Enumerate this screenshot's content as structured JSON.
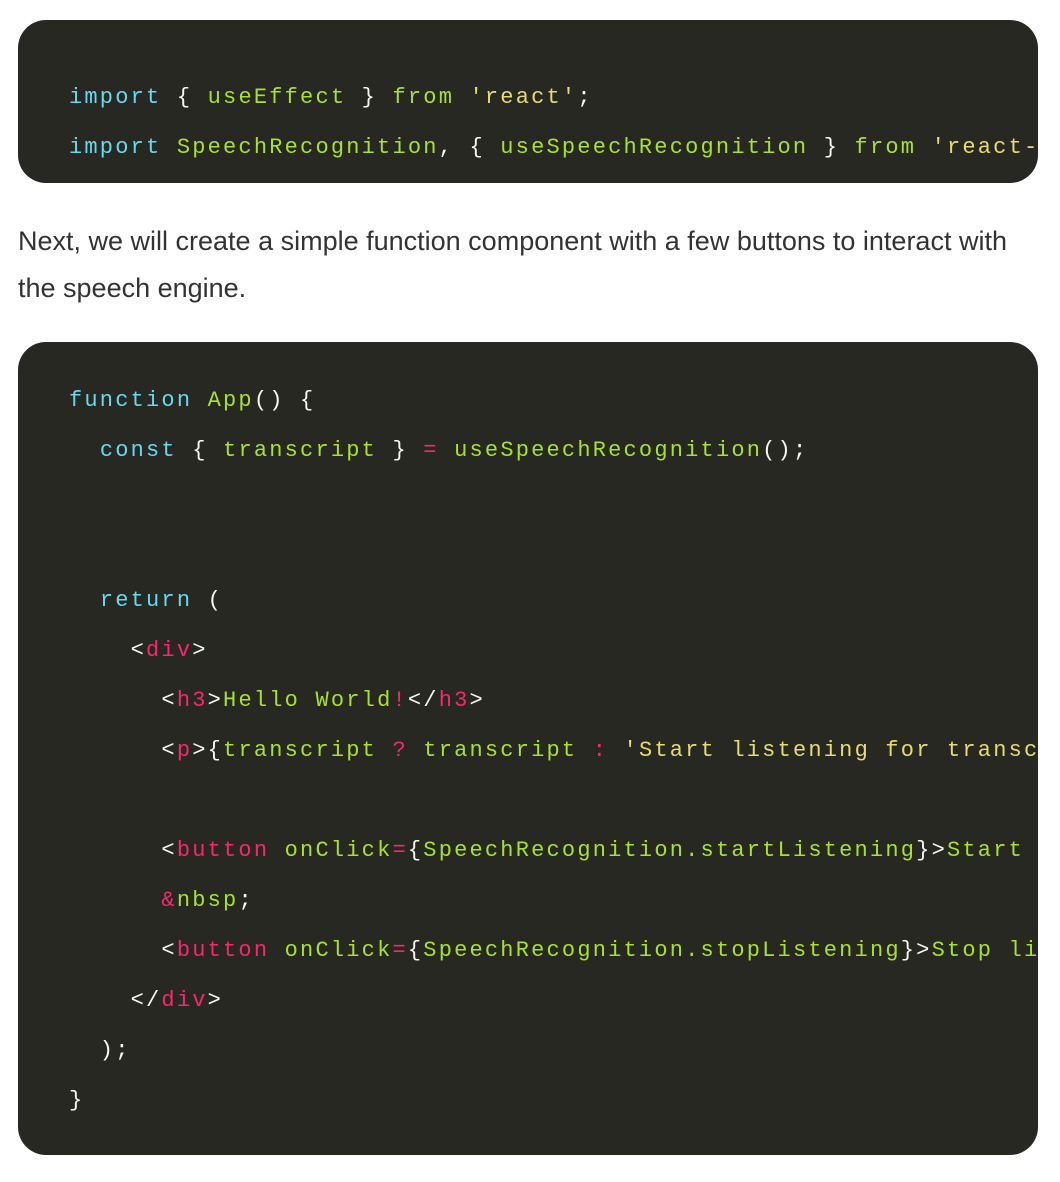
{
  "colors": {
    "background": "#272822",
    "keyword": "#66d9ef",
    "name": "#a6e22e",
    "string": "#e6db74",
    "tag": "#f92672",
    "plain": "#f8f8f2"
  },
  "code_block_1": {
    "lines": [
      [
        {
          "c": "k",
          "t": "import"
        },
        {
          "c": "w",
          "t": " { "
        },
        {
          "c": "g",
          "t": "useEffect"
        },
        {
          "c": "w",
          "t": " } "
        },
        {
          "c": "g",
          "t": "from"
        },
        {
          "c": "w",
          "t": " "
        },
        {
          "c": "y",
          "t": "'react'"
        },
        {
          "c": "w",
          "t": ";"
        }
      ],
      [
        {
          "c": "k",
          "t": "import"
        },
        {
          "c": "w",
          "t": " "
        },
        {
          "c": "g",
          "t": "SpeechRecognition"
        },
        {
          "c": "w",
          "t": ", { "
        },
        {
          "c": "g",
          "t": "useSpeechRecognition"
        },
        {
          "c": "w",
          "t": " } "
        },
        {
          "c": "g",
          "t": "from"
        },
        {
          "c": "w",
          "t": " "
        },
        {
          "c": "y",
          "t": "'react-spe"
        }
      ]
    ]
  },
  "paragraph": "Next, we will create a simple function component with a few buttons to interact with the speech engine.",
  "code_block_2": {
    "lines": [
      [
        {
          "c": "k",
          "t": "function"
        },
        {
          "c": "w",
          "t": " "
        },
        {
          "c": "g",
          "t": "App"
        },
        {
          "c": "w",
          "t": "() {"
        }
      ],
      [
        {
          "c": "w",
          "t": "  "
        },
        {
          "c": "k",
          "t": "const"
        },
        {
          "c": "w",
          "t": " { "
        },
        {
          "c": "g",
          "t": "transcript"
        },
        {
          "c": "w",
          "t": " } "
        },
        {
          "c": "p",
          "t": "="
        },
        {
          "c": "w",
          "t": " "
        },
        {
          "c": "g",
          "t": "useSpeechRecognition"
        },
        {
          "c": "w",
          "t": "();"
        }
      ],
      [],
      [],
      [
        {
          "c": "w",
          "t": "  "
        },
        {
          "c": "k",
          "t": "return"
        },
        {
          "c": "w",
          "t": " ("
        }
      ],
      [
        {
          "c": "w",
          "t": "    <"
        },
        {
          "c": "p",
          "t": "div"
        },
        {
          "c": "w",
          "t": ">"
        }
      ],
      [
        {
          "c": "w",
          "t": "      <"
        },
        {
          "c": "p",
          "t": "h3"
        },
        {
          "c": "w",
          "t": ">"
        },
        {
          "c": "g",
          "t": "Hello World"
        },
        {
          "c": "p",
          "t": "!"
        },
        {
          "c": "w",
          "t": "</"
        },
        {
          "c": "p",
          "t": "h3"
        },
        {
          "c": "w",
          "t": ">"
        }
      ],
      [
        {
          "c": "w",
          "t": "      <"
        },
        {
          "c": "p",
          "t": "p"
        },
        {
          "c": "w",
          "t": ">{"
        },
        {
          "c": "g",
          "t": "transcript"
        },
        {
          "c": "p",
          "t": " ? "
        },
        {
          "c": "g",
          "t": "transcript"
        },
        {
          "c": "p",
          "t": " : "
        },
        {
          "c": "y",
          "t": "'Start listening for transcrip"
        }
      ],
      [],
      [
        {
          "c": "w",
          "t": "      <"
        },
        {
          "c": "p",
          "t": "button"
        },
        {
          "c": "w",
          "t": " "
        },
        {
          "c": "g",
          "t": "onClick"
        },
        {
          "c": "p",
          "t": "="
        },
        {
          "c": "w",
          "t": "{"
        },
        {
          "c": "g",
          "t": "SpeechRecognition.startListening"
        },
        {
          "c": "w",
          "t": "}>"
        },
        {
          "c": "g",
          "t": "Start lis"
        }
      ],
      [
        {
          "c": "w",
          "t": "      "
        },
        {
          "c": "p",
          "t": "&"
        },
        {
          "c": "g",
          "t": "nbsp"
        },
        {
          "c": "w",
          "t": ";"
        }
      ],
      [
        {
          "c": "w",
          "t": "      <"
        },
        {
          "c": "p",
          "t": "button"
        },
        {
          "c": "w",
          "t": " "
        },
        {
          "c": "g",
          "t": "onClick"
        },
        {
          "c": "p",
          "t": "="
        },
        {
          "c": "w",
          "t": "{"
        },
        {
          "c": "g",
          "t": "SpeechRecognition.stopListening"
        },
        {
          "c": "w",
          "t": "}>"
        },
        {
          "c": "g",
          "t": "Stop liste"
        }
      ],
      [
        {
          "c": "w",
          "t": "    </"
        },
        {
          "c": "p",
          "t": "div"
        },
        {
          "c": "w",
          "t": ">"
        }
      ],
      [
        {
          "c": "w",
          "t": "  );"
        }
      ],
      [
        {
          "c": "w",
          "t": "}"
        }
      ]
    ]
  }
}
